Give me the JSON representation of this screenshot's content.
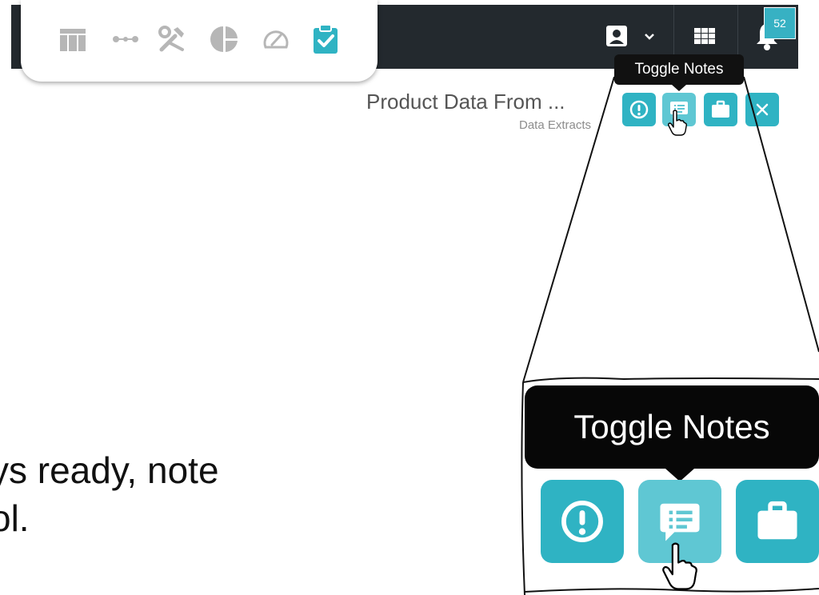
{
  "header": {
    "notifications_count": "52",
    "tools": [
      {
        "name": "table-icon"
      },
      {
        "name": "connector-icon"
      },
      {
        "name": "tools-icon"
      },
      {
        "name": "pie-chart-icon"
      },
      {
        "name": "gauge-icon"
      },
      {
        "name": "clipboard-check-icon",
        "active": true
      }
    ]
  },
  "tooltip": {
    "label": "Toggle Notes"
  },
  "context": {
    "title": "Product Data From ...",
    "subtitle": "Data Extracts"
  },
  "actions": [
    {
      "name": "info-button",
      "icon": "exclamation-circle-icon"
    },
    {
      "name": "toggle-notes-button",
      "icon": "notes-icon",
      "hovered": true
    },
    {
      "name": "briefcase-button",
      "icon": "briefcase-icon"
    },
    {
      "name": "close-button",
      "icon": "close-icon"
    }
  ],
  "caption": {
    "line1": "ys ready, note",
    "line2": "ol."
  },
  "colors": {
    "header_bg": "#23292e",
    "accent": "#2fb3c3",
    "accent_hover": "#5fc7d3",
    "tool_gray": "#b6b6b6"
  }
}
